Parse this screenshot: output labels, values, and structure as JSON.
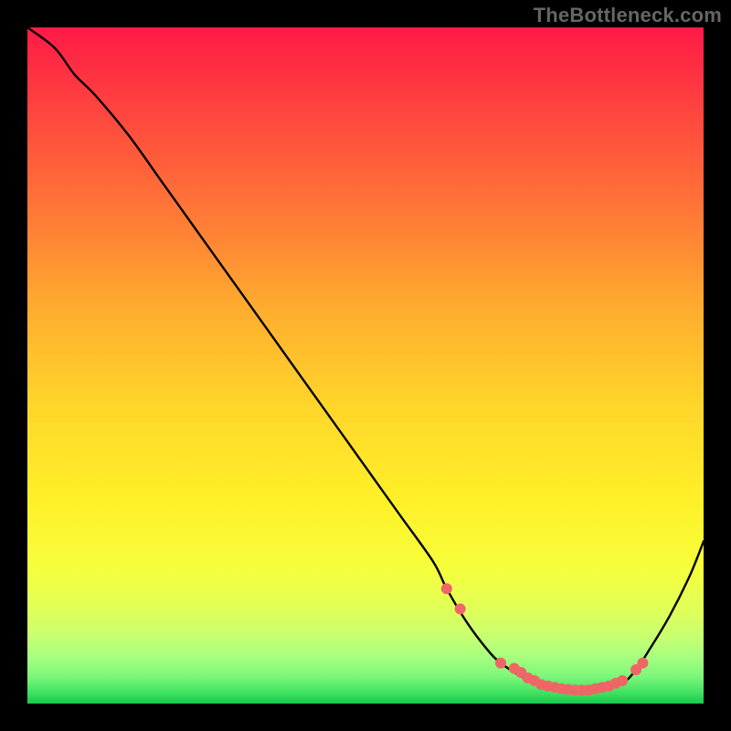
{
  "watermark": "TheBottleneck.com",
  "chart_data": {
    "type": "line",
    "title": "",
    "xlabel": "",
    "ylabel": "",
    "xlim": [
      0,
      100
    ],
    "ylim": [
      0,
      100
    ],
    "series": [
      {
        "name": "curve",
        "x": [
          0,
          4,
          7,
          10,
          15,
          20,
          25,
          30,
          35,
          40,
          45,
          50,
          55,
          60,
          62,
          65,
          68,
          70,
          73,
          76,
          79,
          82,
          85,
          88,
          90,
          92,
          95,
          98,
          100
        ],
        "values": [
          100,
          97,
          93,
          90,
          84,
          77,
          70,
          63,
          56,
          49,
          42,
          35,
          28,
          21,
          17,
          12,
          8,
          6,
          4,
          2.5,
          2,
          2,
          2.2,
          3,
          5,
          8,
          13,
          19,
          24
        ]
      }
    ],
    "markers": {
      "name": "dots",
      "color": "#f06565",
      "x": [
        62,
        64,
        70,
        72,
        73,
        74,
        75,
        76,
        77,
        78,
        79,
        80,
        81,
        82,
        83,
        84,
        85,
        86,
        87,
        88,
        90,
        91
      ],
      "values": [
        17,
        14,
        6,
        5.2,
        4.6,
        3.8,
        3.4,
        2.8,
        2.6,
        2.4,
        2.2,
        2.1,
        2.0,
        2.0,
        2.0,
        2.2,
        2.4,
        2.6,
        3.0,
        3.4,
        5.0,
        6.0
      ]
    },
    "gradient_stops": [
      {
        "offset": 0.0,
        "color": "#ff1a46"
      },
      {
        "offset": 0.14,
        "color": "#ff4a3e"
      },
      {
        "offset": 0.28,
        "color": "#ff7a36"
      },
      {
        "offset": 0.42,
        "color": "#ffae2e"
      },
      {
        "offset": 0.56,
        "color": "#ffd62a"
      },
      {
        "offset": 0.7,
        "color": "#fff028"
      },
      {
        "offset": 0.8,
        "color": "#f6ff3c"
      },
      {
        "offset": 0.86,
        "color": "#e0ff58"
      },
      {
        "offset": 0.9,
        "color": "#c8ff70"
      },
      {
        "offset": 0.93,
        "color": "#a8ff7e"
      },
      {
        "offset": 0.96,
        "color": "#7cf77a"
      },
      {
        "offset": 0.985,
        "color": "#3de060"
      },
      {
        "offset": 1.0,
        "color": "#15c94a"
      }
    ]
  }
}
